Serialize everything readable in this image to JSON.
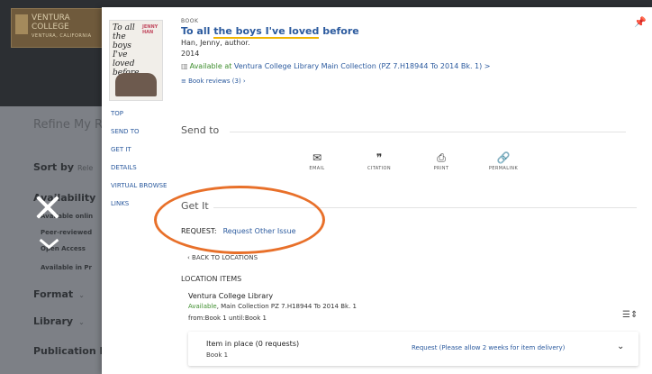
{
  "background": {
    "logo_line1": "VENTURA",
    "logo_line2": "COLLEGE",
    "logo_sub": "VENTURA, CALIFORNIA",
    "refine_title": "Refine My R",
    "sort_label": "Sort by",
    "sort_value": "Rele",
    "availability_label": "Availability",
    "availability_items": [
      "Available onlin",
      "Peer-reviewed",
      "Open Access",
      "Available in Pr"
    ],
    "format_label": "Format",
    "library_label": "Library",
    "publication_label": "Publication I"
  },
  "record": {
    "type": "BOOK",
    "title_pre": "To all ",
    "title_hl": "the boys I've loved",
    "title_post": " before",
    "author": "Han, Jenny, author.",
    "year": "2014",
    "availability_status": "Available at",
    "availability_location": "Ventura College Library  Main Collection (PZ 7.H18944 To 2014 Bk. 1)",
    "availability_chevron": ">",
    "reviews": "Book reviews (3)",
    "cover_text": "To all the boys I've loved before",
    "cover_author": "JENNY HAN"
  },
  "sidenav": [
    "TOP",
    "SEND TO",
    "GET IT",
    "DETAILS",
    "VIRTUAL BROWSE",
    "LINKS"
  ],
  "send_to": {
    "title": "Send to",
    "actions": [
      {
        "label": "EMAIL",
        "icon": "email-icon",
        "glyph": "✉"
      },
      {
        "label": "CITATION",
        "icon": "citation-icon",
        "glyph": "❞"
      },
      {
        "label": "PRINT",
        "icon": "print-icon",
        "glyph": "⎙"
      },
      {
        "label": "PERMALINK",
        "icon": "permalink-icon",
        "glyph": "🔗"
      }
    ]
  },
  "get_it": {
    "title": "Get It",
    "request_label": "REQUEST:",
    "request_link": "Request Other Issue",
    "back_to_locations": "BACK TO LOCATIONS",
    "location_items_label": "LOCATION ITEMS",
    "location_name": "Ventura College Library",
    "location_available": "Available",
    "location_detail": ", Main Collection PZ 7.H18944 To 2014 Bk. 1",
    "location_range": "from:Book 1 until:Book 1",
    "item": {
      "status": "Item in place (0 requests)",
      "book": "Book 1",
      "request": "Request (Please allow 2 weeks for item delivery)"
    }
  },
  "colors": {
    "accent": "#2b5a9e",
    "available": "#3e8e2e",
    "highlight_ring": "#e8702a"
  }
}
